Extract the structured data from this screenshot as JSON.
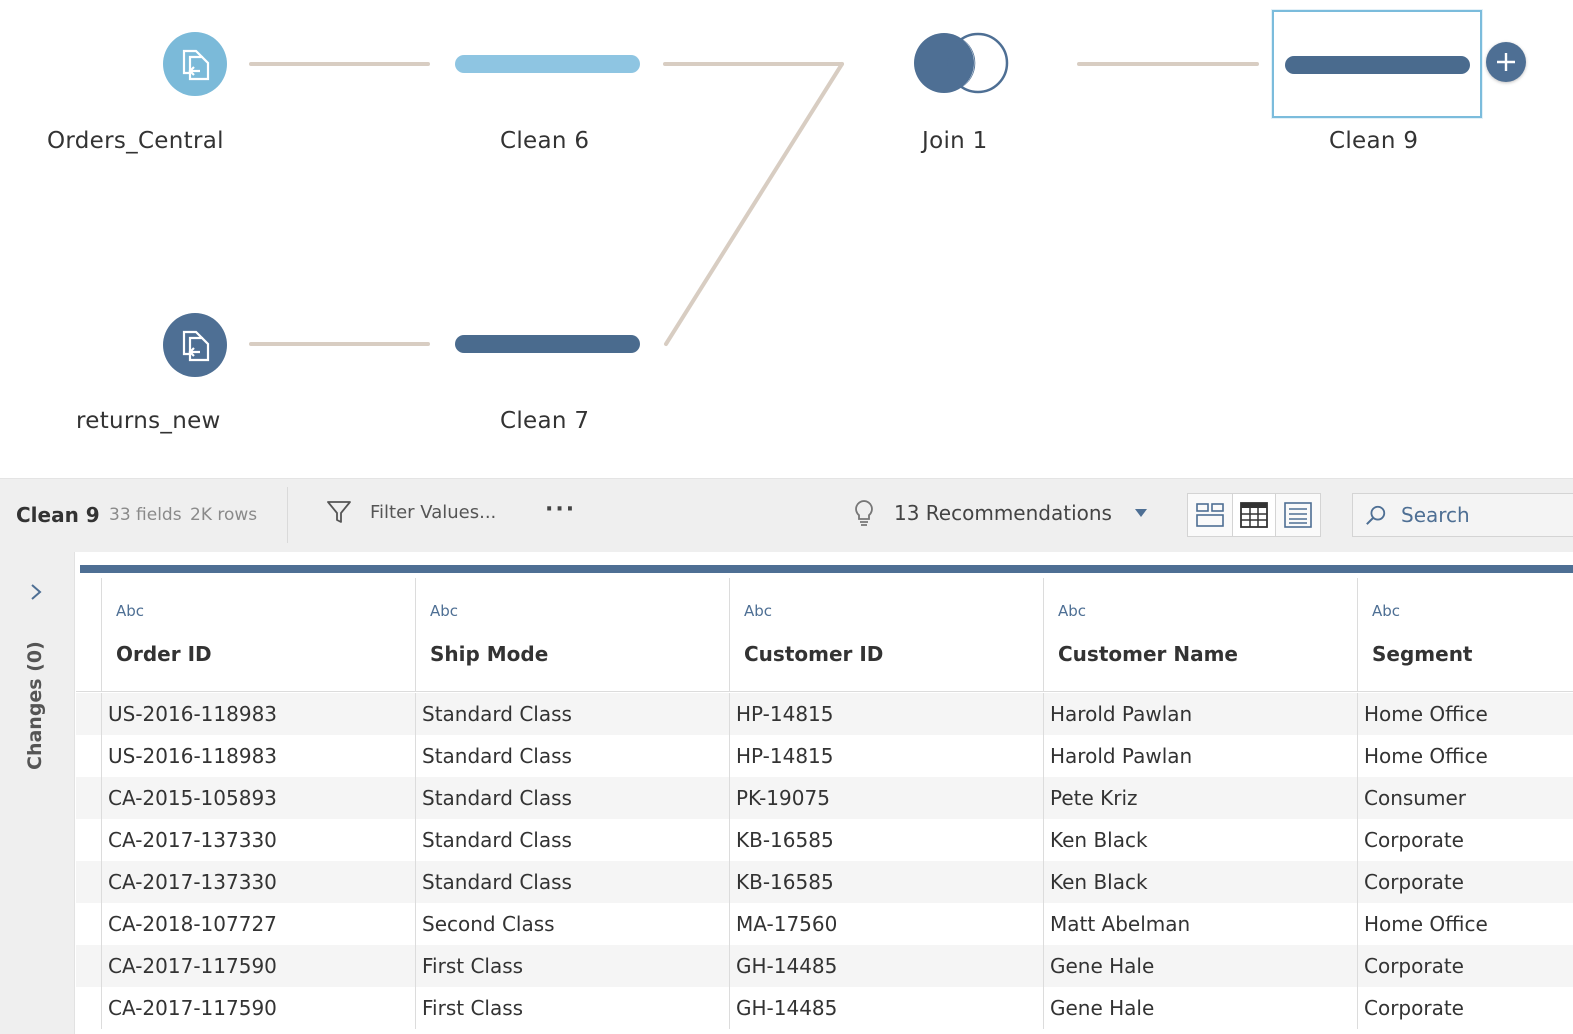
{
  "flow": {
    "nodes": {
      "orders_central": {
        "label": "Orders_Central"
      },
      "returns_new": {
        "label": "returns_new"
      },
      "clean6": {
        "label": "Clean 6"
      },
      "clean7": {
        "label": "Clean 7"
      },
      "join1": {
        "label": "Join 1"
      },
      "clean9": {
        "label": "Clean 9"
      }
    },
    "colors": {
      "line": "#d8cdc2",
      "light_node": "#7bbad9",
      "dark_node": "#4e6f94",
      "selection": "#7bbcdc"
    }
  },
  "toolbar": {
    "step_name": "Clean 9",
    "fields": "33 fields",
    "rows": "2K rows",
    "filter_label": "Filter Values...",
    "more_label": "···",
    "recommendations": "13 Recommendations",
    "search_placeholder": "Search"
  },
  "changes": {
    "label": "Changes (0)"
  },
  "grid": {
    "columns": [
      {
        "type": "Abc",
        "name": "Order ID"
      },
      {
        "type": "Abc",
        "name": "Ship Mode"
      },
      {
        "type": "Abc",
        "name": "Customer ID"
      },
      {
        "type": "Abc",
        "name": "Customer Name"
      },
      {
        "type": "Abc",
        "name": "Segment"
      }
    ],
    "rows": [
      [
        "US-2016-118983",
        "Standard Class",
        "HP-14815",
        "Harold Pawlan",
        "Home Office"
      ],
      [
        "US-2016-118983",
        "Standard Class",
        "HP-14815",
        "Harold Pawlan",
        "Home Office"
      ],
      [
        "CA-2015-105893",
        "Standard Class",
        "PK-19075",
        "Pete Kriz",
        "Consumer"
      ],
      [
        "CA-2017-137330",
        "Standard Class",
        "KB-16585",
        "Ken Black",
        "Corporate"
      ],
      [
        "CA-2017-137330",
        "Standard Class",
        "KB-16585",
        "Ken Black",
        "Corporate"
      ],
      [
        "CA-2018-107727",
        "Second Class",
        "MA-17560",
        "Matt Abelman",
        "Home Office"
      ],
      [
        "CA-2017-117590",
        "First Class",
        "GH-14485",
        "Gene Hale",
        "Corporate"
      ],
      [
        "CA-2017-117590",
        "First Class",
        "GH-14485",
        "Gene Hale",
        "Corporate"
      ]
    ]
  }
}
